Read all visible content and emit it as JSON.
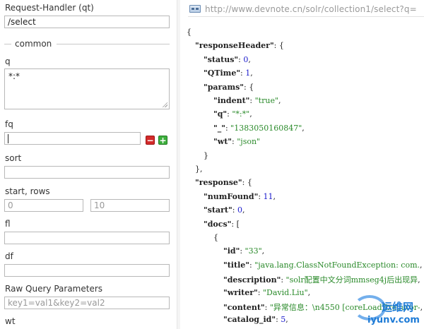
{
  "form": {
    "request_handler_label": "Request-Handler (qt)",
    "request_handler_value": "/select",
    "common_legend": "common",
    "q_label": "q",
    "q_value": "*:*",
    "fq_label": "fq",
    "fq_value": "",
    "remove_icon_glyph": "−",
    "add_icon_glyph": "+",
    "sort_label": "sort",
    "sort_value": "",
    "start_rows_label": "start, rows",
    "start_value": "0",
    "rows_value": "10",
    "fl_label": "fl",
    "fl_value": "",
    "df_label": "df",
    "df_value": "",
    "raw_label": "Raw Query Parameters",
    "raw_placeholder": "key1=val1&key2=val2",
    "wt_label": "wt"
  },
  "response": {
    "url": "http://www.devnote.cn/solr/collection1/select?q=",
    "lines": [
      {
        "k": "",
        "v": "{",
        "t": "p"
      },
      {
        "k": "\"responseHeader\"",
        "v": ": {",
        "t": "p"
      },
      {
        "k": "\"status\"",
        "v": "0",
        "t": "n"
      },
      {
        "k": "\"QTime\"",
        "v": "1",
        "t": "n"
      },
      {
        "k": "\"params\"",
        "v": ": {",
        "t": "p"
      },
      {
        "k": "\"indent\"",
        "v": "\"true\"",
        "t": "s"
      },
      {
        "k": "\"q\"",
        "v": "\"*:*\"",
        "t": "s"
      },
      {
        "k": "\"_\"",
        "v": "\"1383050160847\"",
        "t": "s"
      },
      {
        "k": "\"wt\"",
        "v": "\"json\"",
        "t": "s"
      },
      {
        "k": "",
        "v": "}",
        "t": "p"
      },
      {
        "k": "",
        "v": "},",
        "t": "p"
      },
      {
        "k": "\"response\"",
        "v": ": {",
        "t": "p"
      },
      {
        "k": "\"numFound\"",
        "v": "11",
        "t": "n"
      },
      {
        "k": "\"start\"",
        "v": "0",
        "t": "n"
      },
      {
        "k": "\"docs\"",
        "v": ": [",
        "t": "p"
      },
      {
        "k": "",
        "v": "{",
        "t": "p"
      },
      {
        "k": "\"id\"",
        "v": "\"33\"",
        "t": "s"
      },
      {
        "k": "\"title\"",
        "v": "\"java.lang.ClassNotFoundException: com.",
        "t": "s"
      },
      {
        "k": "\"description\"",
        "v": "\"solr配置中文分词mmseg4j后出现异",
        "t": "s"
      },
      {
        "k": "\"writer\"",
        "v": "\"David.Liu\"",
        "t": "s"
      },
      {
        "k": "\"content\"",
        "v": "\"异常信息：\\n4550 [coreLoadExecutor-",
        "t": "s"
      },
      {
        "k": "\"catalog_id\"",
        "v": "5",
        "t": "n"
      }
    ]
  },
  "watermark": {
    "cn": "运维网",
    "url": "iyunv.com"
  }
}
